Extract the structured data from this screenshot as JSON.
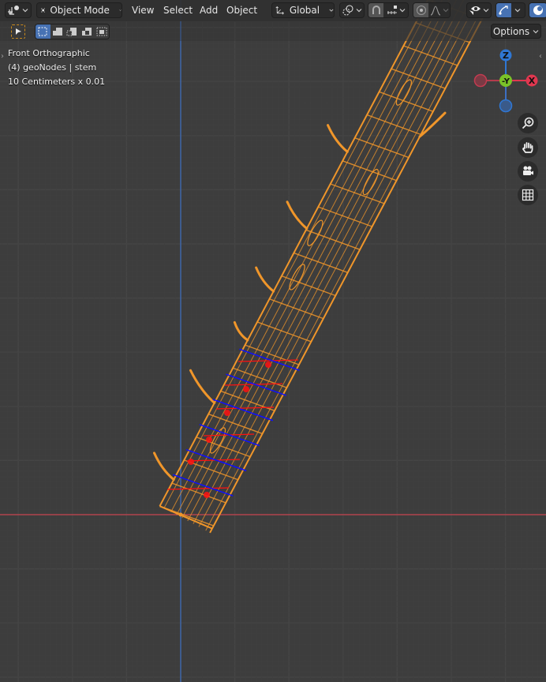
{
  "header": {
    "editor_type_icon": "3d-viewport-icon",
    "mode": {
      "icon": "object-mode-icon",
      "label": "Object Mode"
    },
    "menus": [
      "View",
      "Select",
      "Add",
      "Object"
    ],
    "transform_orientation": {
      "icon": "global-axes-icon",
      "label": "Global"
    },
    "pivot_icon": "pivot-point-icon",
    "snap": {
      "icon": "magnet-icon",
      "active": true,
      "increment_icon": "snap-increment-icon"
    },
    "proportional_edit": {
      "icon": "proportional-edit-icon",
      "falloff_icon": "falloff-curve-icon"
    },
    "visibility_icon": "selectability-visibility-icon",
    "gizmo_icon": "gizmo-toggle-icon",
    "overlay_icon": "viewport-shading-icon"
  },
  "toolbar": {
    "active_tool_icon": "select-cursor-icon",
    "select_modes": [
      {
        "name": "set-new-selection",
        "active": true
      },
      {
        "name": "extend-selection",
        "active": false
      },
      {
        "name": "subtract-selection",
        "active": false
      },
      {
        "name": "invert-selection",
        "active": false
      },
      {
        "name": "intersect-selection",
        "active": false
      }
    ],
    "options_label": "Options"
  },
  "viewport": {
    "view_name": "Front Orthographic",
    "object_info": "(4) geoNodes | stem",
    "scale_info": "10 Centimeters x 0.01",
    "colors": {
      "background": "#3d3d3d",
      "grid": "#4a4a4a",
      "x_axis": "#c8434f",
      "z_axis": "#3d6fc2",
      "wire_selected": "#f0962a",
      "annotation_red": "#ff1010",
      "annotation_blue": "#1010ff"
    }
  },
  "gizmo": {
    "axes": [
      {
        "label": "Z",
        "color": "#2f77d4"
      },
      {
        "label": "-Y",
        "color": "#7ac228"
      },
      {
        "label": "X",
        "color": "#e0374f"
      },
      {
        "label": "",
        "color": "#b43b4c"
      },
      {
        "label": "",
        "color": "#3a5a8a"
      }
    ]
  },
  "nav_buttons": [
    {
      "name": "zoom",
      "icon": "zoom-in-icon"
    },
    {
      "name": "pan",
      "icon": "hand-icon"
    },
    {
      "name": "camera",
      "icon": "camera-icon"
    },
    {
      "name": "ortho-toggle",
      "icon": "grid-icon"
    }
  ]
}
